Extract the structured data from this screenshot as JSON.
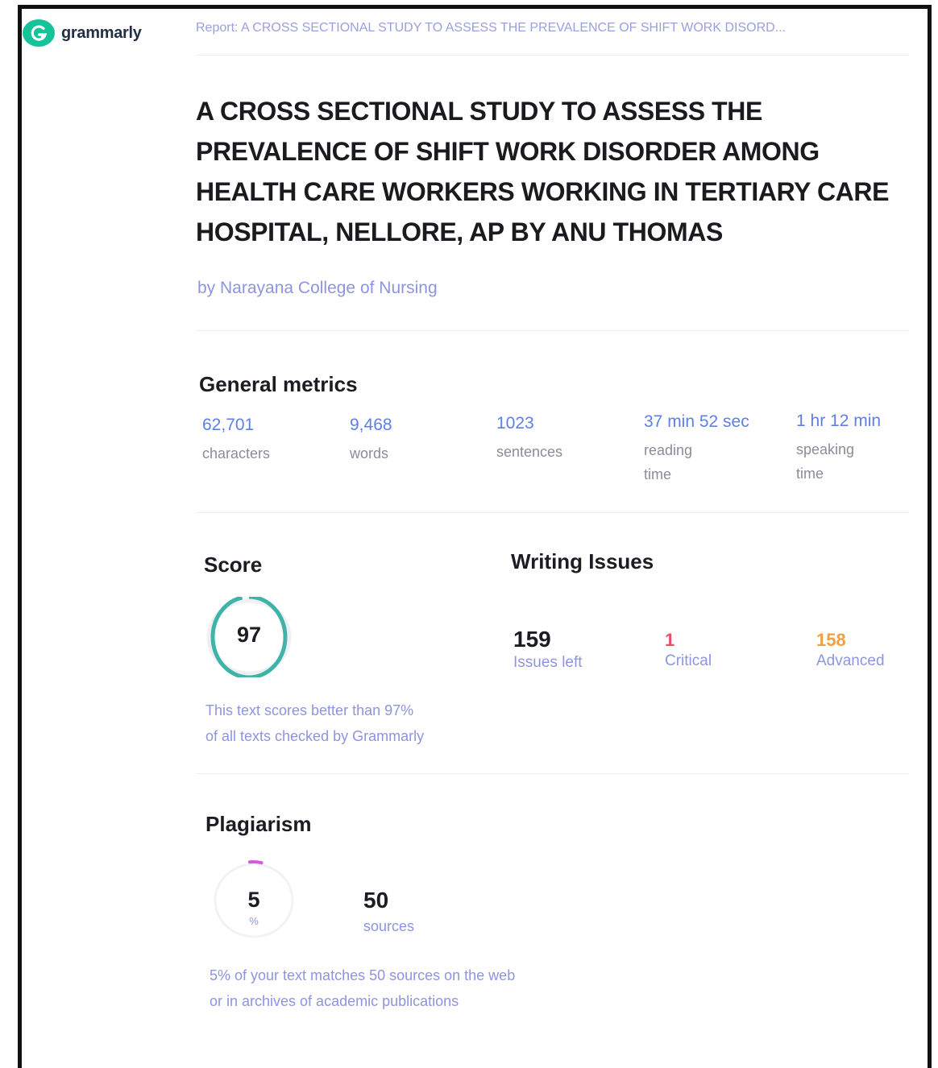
{
  "brand": {
    "name": "grammarly",
    "icon": "grammarly-g-icon",
    "color": "#15c39a"
  },
  "header": {
    "report_title": "Report: A CROSS SECTIONAL STUDY TO ASSESS THE PREVALENCE OF SHIFT WORK DISORD..."
  },
  "document": {
    "title": "A CROSS SECTIONAL STUDY TO ASSESS THE PREVALENCE OF SHIFT WORK DISORDER AMONG HEALTH CARE WORKERS WORKING IN TERTIARY CARE HOSPITAL, NELLORE, AP BY ANU THOMAS",
    "author": "by Narayana College of Nursing"
  },
  "general_metrics": {
    "title": "General metrics",
    "items": [
      {
        "value": "62,701",
        "label": "characters"
      },
      {
        "value": "9,468",
        "label": "words"
      },
      {
        "value": "1023",
        "label": "sentences"
      },
      {
        "value": "37 min 52 sec",
        "label": "reading time"
      },
      {
        "value": "1 hr 12 min",
        "label": "speaking time"
      }
    ]
  },
  "score": {
    "title": "Score",
    "value": "97",
    "percent": 97,
    "color": "#3fb3a8",
    "description_line1": "This text scores better than 97%",
    "description_line2": "of all texts checked by Grammarly"
  },
  "writing_issues": {
    "title": "Writing Issues",
    "items": [
      {
        "value": "159",
        "label": "Issues left",
        "color": "#1c1c22"
      },
      {
        "value": "1",
        "label": "Critical",
        "color": "#e8506a"
      },
      {
        "value": "158",
        "label": "Advanced",
        "color": "#f0a040"
      }
    ]
  },
  "plagiarism": {
    "title": "Plagiarism",
    "value": "5",
    "unit": "%",
    "percent": 5,
    "color": "#d65ad6",
    "sources_value": "50",
    "sources_label": "sources",
    "description_line1": "5% of your text matches 50 sources on the web",
    "description_line2": "or in archives of academic publications"
  }
}
